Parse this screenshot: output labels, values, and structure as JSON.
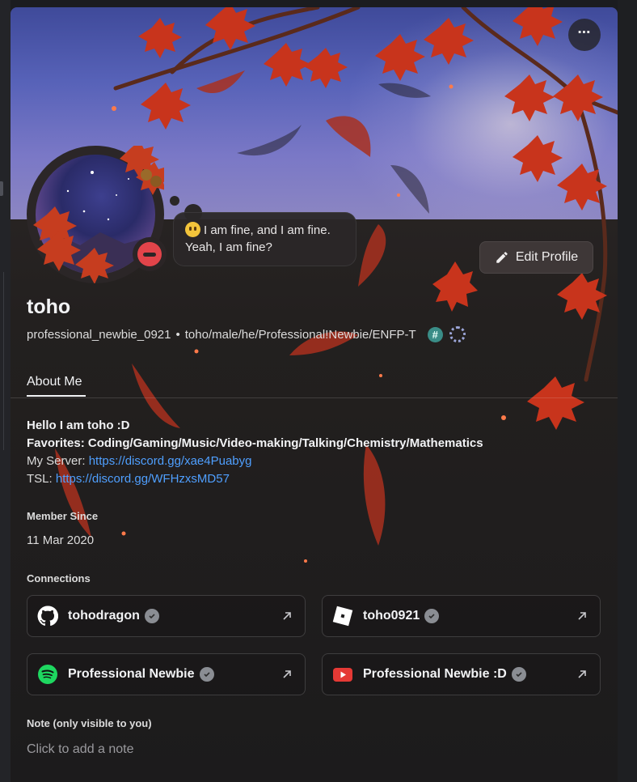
{
  "profile": {
    "display_name": "toho",
    "username": "professional_newbie_0921",
    "separator": "•",
    "pronouns": "toho/male/he/Professional!Newbie/ENFP-T",
    "custom_status": "I am fine, and I am fine. Yeah, I am fine?",
    "status": "do-not-disturb",
    "status_color": "#e2444a"
  },
  "actions": {
    "more_label": "⋯",
    "edit_profile_label": "Edit Profile"
  },
  "tabs": [
    {
      "label": "About Me",
      "selected": true
    }
  ],
  "about": {
    "line1": "Hello I am toho :D",
    "line2": "Favorites: Coding/Gaming/Music/Video-making/Talking/Chemistry/Mathematics",
    "server_label": "My Server: ",
    "server_link": "https://discord.gg/xae4Puabyg",
    "tsl_label": "TSL: ",
    "tsl_link": "https://discord.gg/WFHzxsMD57",
    "link_color": "#4f9fff"
  },
  "member_since": {
    "heading": "Member Since",
    "date": "11 Mar 2020"
  },
  "connections": {
    "heading": "Connections",
    "items": [
      {
        "service": "github",
        "icon": "github-icon",
        "name": "tohodragon",
        "verified": true
      },
      {
        "service": "roblox",
        "icon": "roblox-icon",
        "name": "toho0921",
        "verified": true
      },
      {
        "service": "spotify",
        "icon": "spotify-icon",
        "name": "Professional Newbie",
        "verified": true
      },
      {
        "service": "youtube",
        "icon": "youtube-icon",
        "name": "Professional Newbie :D",
        "verified": true
      }
    ]
  },
  "note": {
    "heading": "Note (only visible to you)",
    "placeholder": "Click to add a note"
  },
  "colors": {
    "banner": "#5762b8",
    "accent_hash_badge": "#3a8d87",
    "spotify": "#1ed760",
    "youtube": "#e53935"
  }
}
